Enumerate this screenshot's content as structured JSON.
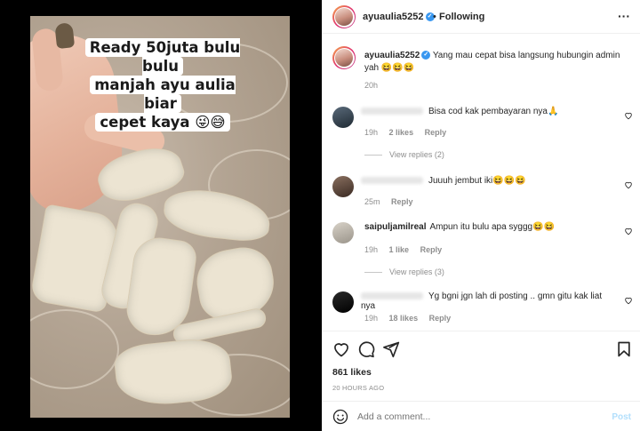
{
  "header": {
    "username": "ayuaulia5252",
    "verified_glyph": "✓",
    "separator": "•",
    "follow_status": "Following",
    "more_glyph": "···"
  },
  "media": {
    "overlay_lines": [
      "Ready 50juta bulu bulu",
      "manjah ayu aulia biar",
      "cepet kaya 😜😅"
    ]
  },
  "caption": {
    "username": "ayuaulia5252",
    "text": "Yang mau cepat bisa langsung hubungin admin yah 😆😆😆",
    "time": "20h"
  },
  "comments": [
    {
      "username": "",
      "text": "Bisa cod kak pembayaran nya🙏",
      "time": "19h",
      "likes": "2 likes",
      "reply": "Reply",
      "view_replies": "View replies (2)"
    },
    {
      "username": "",
      "text": "Juuuh jembut iki😆😆😆",
      "time": "25m",
      "likes": "",
      "reply": "Reply",
      "view_replies": ""
    },
    {
      "username": "saipuljamilreal",
      "text": "Ampun itu bulu apa syggg😆😆",
      "time": "19h",
      "likes": "1 like",
      "reply": "Reply",
      "view_replies": "View replies (3)"
    },
    {
      "username": "",
      "text": "Yg bgni jgn lah di posting .. gmn gitu kak liat nya",
      "time": "19h",
      "likes": "18 likes",
      "reply": "Reply",
      "view_replies": ""
    }
  ],
  "actions": {
    "icons": [
      "heart-icon",
      "comment-icon",
      "share-icon",
      "bookmark-icon"
    ],
    "likes": "861 likes",
    "posted_ago": "20 HOURS AGO"
  },
  "add_comment": {
    "placeholder": "Add a comment...",
    "post_label": "Post"
  },
  "colors": {
    "verified": "#3897f0",
    "muted": "#8e8e8e",
    "post_disabled": "#b2dffc"
  }
}
